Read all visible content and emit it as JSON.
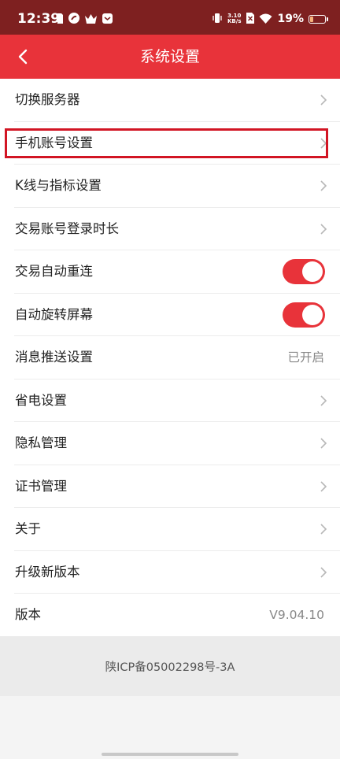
{
  "status_bar": {
    "time": "12:39",
    "net_speed_value": "3.10",
    "net_speed_unit": "KB/s",
    "battery_percent": "19%",
    "battery_level": 0.19,
    "left_icons": [
      "sim-card-icon",
      "tiktok-icon",
      "crown-icon",
      "message-icon"
    ],
    "right_icons": [
      "vibrate-icon",
      "no-sim-icon",
      "wifi-icon",
      "battery-icon"
    ]
  },
  "nav": {
    "title": "系统设置",
    "back_icon": "chevron-left-icon"
  },
  "settings": {
    "items": [
      {
        "label": "切换服务器",
        "type": "link"
      },
      {
        "label": "手机账号设置",
        "type": "link",
        "highlighted": true
      },
      {
        "label": "K线与指标设置",
        "type": "link"
      },
      {
        "label": "交易账号登录时长",
        "type": "link"
      },
      {
        "label": "交易自动重连",
        "type": "toggle",
        "on": true
      },
      {
        "label": "自动旋转屏幕",
        "type": "toggle",
        "on": true
      },
      {
        "label": "消息推送设置",
        "type": "value",
        "value": "已开启"
      },
      {
        "label": "省电设置",
        "type": "link"
      },
      {
        "label": "隐私管理",
        "type": "link"
      },
      {
        "label": "证书管理",
        "type": "link"
      },
      {
        "label": "关于",
        "type": "link"
      },
      {
        "label": "升级新版本",
        "type": "link"
      },
      {
        "label": "版本",
        "type": "value",
        "value": "V9.04.10"
      }
    ]
  },
  "footer": {
    "icp": "陕ICP备05002298号-3A"
  },
  "colors": {
    "status_bar": "#7e2020",
    "nav_bar": "#e8333a",
    "accent": "#e8333a",
    "highlight_border": "#d21524"
  }
}
